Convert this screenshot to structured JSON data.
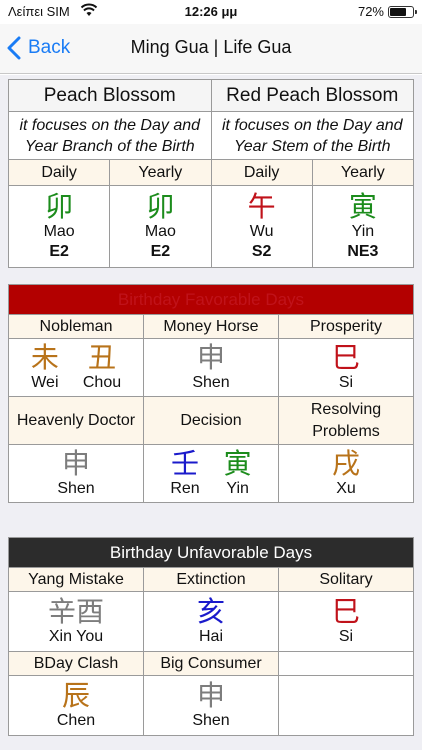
{
  "status": {
    "carrier": "Λείπει SIM",
    "time": "12:26 μμ",
    "battery_pct": "72%",
    "battery_level": 0.72
  },
  "nav": {
    "back_label": "Back",
    "title": "Ming Gua | Life Gua"
  },
  "peach": {
    "left_header": "Peach Blossom",
    "right_header": "Red Peach Blossom",
    "left_desc": "it focuses on the Day and Year Branch of the Birth",
    "right_desc": "it focuses on the Day and Year Stem of the Birth",
    "cols": [
      {
        "label": "Daily",
        "char": "卯",
        "pinyin": "Mao",
        "dir": "E2",
        "color": "green"
      },
      {
        "label": "Yearly",
        "char": "卯",
        "pinyin": "Mao",
        "dir": "E2",
        "color": "green"
      },
      {
        "label": "Daily",
        "char": "午",
        "pinyin": "Wu",
        "dir": "S2",
        "color": "red"
      },
      {
        "label": "Yearly",
        "char": "寅",
        "pinyin": "Yin",
        "dir": "NE3",
        "color": "green"
      }
    ]
  },
  "favorable": {
    "title": "Birthday Favorable Days",
    "row1": [
      {
        "label": "Nobleman",
        "items": [
          {
            "char": "未",
            "pinyin": "Wei",
            "color": "brown"
          },
          {
            "char": "丑",
            "pinyin": "Chou",
            "color": "brown"
          }
        ]
      },
      {
        "label": "Money Horse",
        "items": [
          {
            "char": "申",
            "pinyin": "Shen",
            "color": "gray"
          }
        ]
      },
      {
        "label": "Prosperity",
        "items": [
          {
            "char": "巳",
            "pinyin": "Si",
            "color": "red"
          }
        ]
      }
    ],
    "row2": [
      {
        "label": "Heavenly Doctor",
        "items": [
          {
            "char": "申",
            "pinyin": "Shen",
            "color": "gray"
          }
        ]
      },
      {
        "label": "Decision",
        "items": [
          {
            "char": "壬",
            "pinyin": "Ren",
            "color": "blue"
          },
          {
            "char": "寅",
            "pinyin": "Yin",
            "color": "green"
          }
        ]
      },
      {
        "label": "Resolving Problems",
        "items": [
          {
            "char": "戌",
            "pinyin": "Xu",
            "color": "brown"
          }
        ]
      }
    ]
  },
  "unfavorable": {
    "title": "Birthday Unfavorable Days",
    "row1": [
      {
        "label": "Yang Mistake",
        "char": "辛酉",
        "pinyin": "Xin You",
        "color": "gray"
      },
      {
        "label": "Extinction",
        "char": "亥",
        "pinyin": "Hai",
        "color": "blue"
      },
      {
        "label": "Solitary",
        "char": "巳",
        "pinyin": "Si",
        "color": "red"
      }
    ],
    "row2": [
      {
        "label": "BDay Clash",
        "char": "辰",
        "pinyin": "Chen",
        "color": "brown"
      },
      {
        "label": "Big Consumer",
        "char": "申",
        "pinyin": "Shen",
        "color": "gray"
      }
    ]
  }
}
